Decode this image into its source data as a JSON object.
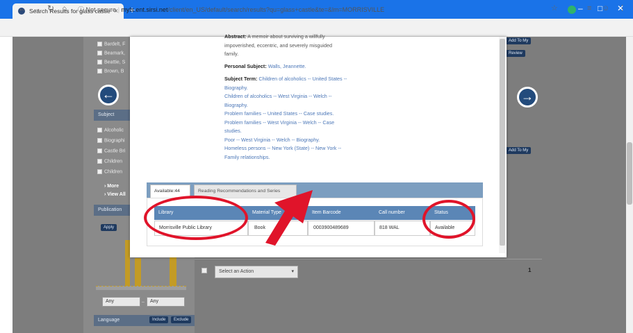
{
  "browser": {
    "tab_title": "Search Results for glass castle",
    "tab_close": "×",
    "new_tab": "+",
    "url_prefix": "Not secure",
    "url_host": "myls.ent.sirsi.net",
    "url_path": "/client/en_US/default/search/results?qu=glass+castle&te=&lm=MORRISVILLE",
    "icons": [
      "back-icon",
      "forward-icon",
      "reload-icon",
      "home-icon",
      "info-icon",
      "star-icon",
      "extension-icon",
      "reading-list-icon",
      "profile-icon",
      "menu-icon"
    ]
  },
  "sidebar": {
    "items_top": [
      "Bardelt, F",
      "Beamark,",
      "Beattie, S",
      "Brown, B"
    ],
    "subject_header": "Subject",
    "subject_items": [
      "Alcoholic",
      "Biographi",
      "Castle Bri",
      "Children",
      "Children"
    ],
    "more": "› More",
    "view_all": "› View All",
    "publication_header": "Publication",
    "apply_label": "Apply",
    "range_from": "Any",
    "range_to": "Any",
    "language_header": "Language",
    "include": "Include",
    "exclude": "Exclude"
  },
  "right_buttons": [
    "Add To My",
    "Review",
    "Add To My"
  ],
  "actions": {
    "select_label": "Select an Action",
    "page_number": "1"
  },
  "detail": {
    "abstract_label": "Abstract:",
    "abstract_text_1": "A memoir about surviving a willfully",
    "abstract_text_2": "impoverished, eccentric, and severely misguided",
    "abstract_text_3": "family.",
    "personal_subject_label": "Personal Subject:",
    "personal_subject": "Walls, Jeannette.",
    "subject_term_label": "Subject Term:",
    "subject_terms": [
      "Children of alcoholics -- United States --",
      "Biography.",
      "Children of alcoholics -- West Virginia -- Welch --",
      "Biography.",
      "Problem families -- United States -- Case studies.",
      "Problem families -- West Virginia -- Welch -- Case",
      "studies.",
      "Poor -- West Virginia -- Welch -- Biography.",
      "Homeless persons -- New York (State) -- New York --",
      "Family relationships."
    ]
  },
  "holdings": {
    "tab_available": "Available:44",
    "tab_reading": "Reading Recommendations and Series",
    "headers": [
      "Library",
      "Material Type",
      "Item Barcode",
      "Call number",
      "Status"
    ],
    "rows": [
      [
        "Morrisville Public Library",
        "Book",
        "0003900489689",
        "818 WAL",
        "Available"
      ]
    ]
  },
  "colors": {
    "chrome_blue": "#1a73e8",
    "table_header": "#5b86b6",
    "annotation_red": "#e0142a",
    "nav_arrow": "#234b7c"
  }
}
